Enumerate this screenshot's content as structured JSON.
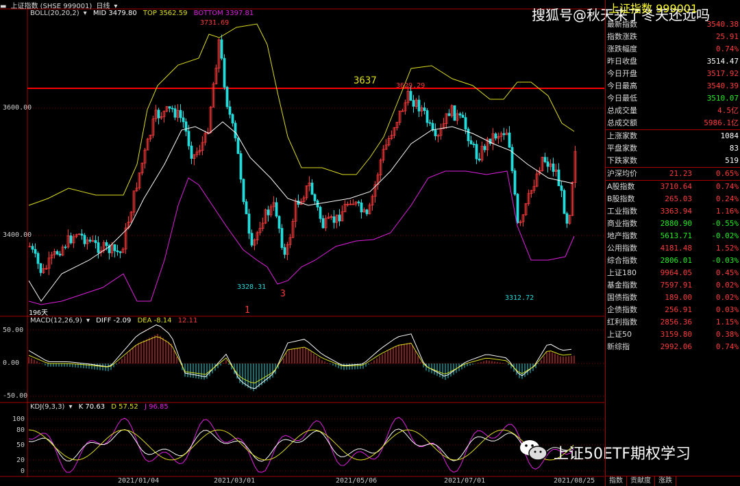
{
  "window": {
    "title": "上证指数 (SHSE 999001)",
    "period": "日线",
    "dropdown_icon": "chevron-down-icon"
  },
  "legends": {
    "boll": {
      "name": "BOLL(20,20,2)",
      "mid": "MID 3479.80",
      "top": "TOP 3562.59",
      "bottom": "BOTTOM 3397.81"
    },
    "macd": {
      "name": "MACD(12,26,9)",
      "diff": "DIFF -2.09",
      "dea": "DEA -8.14",
      "macd": "12.11"
    },
    "kdj": {
      "name": "KDJ(9,3,3)",
      "k": "K 70.63",
      "d": "D 57.52",
      "j": "J 96.85"
    }
  },
  "colors": {
    "up": "#ff3b3b",
    "down": "#22dddd",
    "mid": "#ffffff",
    "top": "#e0e020",
    "bottom": "#e020e0",
    "resistance": "#ff0000",
    "panel_up": "#ff3b3b",
    "panel_down": "#22ee22"
  },
  "price_axis": {
    "ticks": [
      "3600.00",
      "3400.00"
    ]
  },
  "macd_axis": {
    "ticks": [
      "50.00",
      "0.00",
      "-50.00"
    ]
  },
  "kdj_axis": {
    "ticks": [
      "100",
      "80",
      "50",
      "20",
      "0"
    ]
  },
  "date_axis": {
    "ticks": [
      "2021/01/04",
      "2021/03/01",
      "2021/05/06",
      "2021/07/01",
      "2021/08/25"
    ]
  },
  "annotations": {
    "high1": "3731.69",
    "high2": "3629.29",
    "low1": "3328.31",
    "low2": "3312.72",
    "resistance": "3637",
    "wave1": "1",
    "wave3": "3",
    "days": "196天"
  },
  "panel": {
    "title": "上证指数 999001",
    "quote": [
      {
        "label": "最新指数",
        "value": "3540.38",
        "tone": "up"
      },
      {
        "label": "指数涨跌",
        "value": "25.91",
        "tone": "up"
      },
      {
        "label": "涨跌幅度",
        "value": "0.74%",
        "tone": "up"
      },
      {
        "label": "昨日收盘",
        "value": "3514.47",
        "tone": "wt"
      },
      {
        "label": "今日开盘",
        "value": "3517.92",
        "tone": "up"
      },
      {
        "label": "今日最高",
        "value": "3540.39",
        "tone": "up"
      },
      {
        "label": "今日最低",
        "value": "3510.07",
        "tone": "dn"
      },
      {
        "label": "总成交量",
        "value": "4.5亿",
        "tone": "up"
      },
      {
        "label": "总成交额",
        "value": "5986.1亿",
        "tone": "up"
      }
    ],
    "breadth": [
      {
        "label": "上涨家数",
        "value": "1084",
        "tone": "wt"
      },
      {
        "label": "平盘家数",
        "value": "83",
        "tone": "wt"
      },
      {
        "label": "下跌家数",
        "value": "519",
        "tone": "wt"
      }
    ],
    "hs_avg": {
      "label": "沪深均价",
      "value": "21.23",
      "pct": "0.65%"
    },
    "indices": [
      {
        "label": "A股指数",
        "value": "3710.64",
        "pct": "0.74%",
        "tone": "up"
      },
      {
        "label": "B股指数",
        "value": "265.03",
        "pct": "0.24%",
        "tone": "up"
      },
      {
        "label": "工业指数",
        "value": "3363.94",
        "pct": "1.16%",
        "tone": "up"
      },
      {
        "label": "商业指数",
        "value": "2880.90",
        "pct": "-0.55%",
        "tone": "dn"
      },
      {
        "label": "地产指数",
        "value": "5613.71",
        "pct": "-0.02%",
        "tone": "dn"
      },
      {
        "label": "公用指数",
        "value": "4181.48",
        "pct": "1.52%",
        "tone": "up"
      },
      {
        "label": "综合指数",
        "value": "2806.01",
        "pct": "-0.03%",
        "tone": "dn"
      },
      {
        "label": "上证180",
        "value": "9964.05",
        "pct": "0.45%",
        "tone": "up"
      },
      {
        "label": "基金指数",
        "value": "7597.91",
        "pct": "0.02%",
        "tone": "up"
      },
      {
        "label": "国债指数",
        "value": "189.00",
        "pct": "0.02%",
        "tone": "up"
      },
      {
        "label": "企债指数",
        "value": "256.91",
        "pct": "0.03%",
        "tone": "up"
      },
      {
        "label": "红利指数",
        "value": "2856.36",
        "pct": "1.15%",
        "tone": "up"
      },
      {
        "label": "上证50",
        "value": "3159.80",
        "pct": "0.38%",
        "tone": "up"
      },
      {
        "label": "新综指",
        "value": "2992.06",
        "pct": "0.74%",
        "tone": "up"
      }
    ],
    "tabs": [
      "指数",
      "贡献度",
      "涨跌"
    ]
  },
  "watermark": {
    "top": "搜狐号@秋天来了冬天还远吗",
    "bottom": "上证50ETF期权学习"
  }
}
